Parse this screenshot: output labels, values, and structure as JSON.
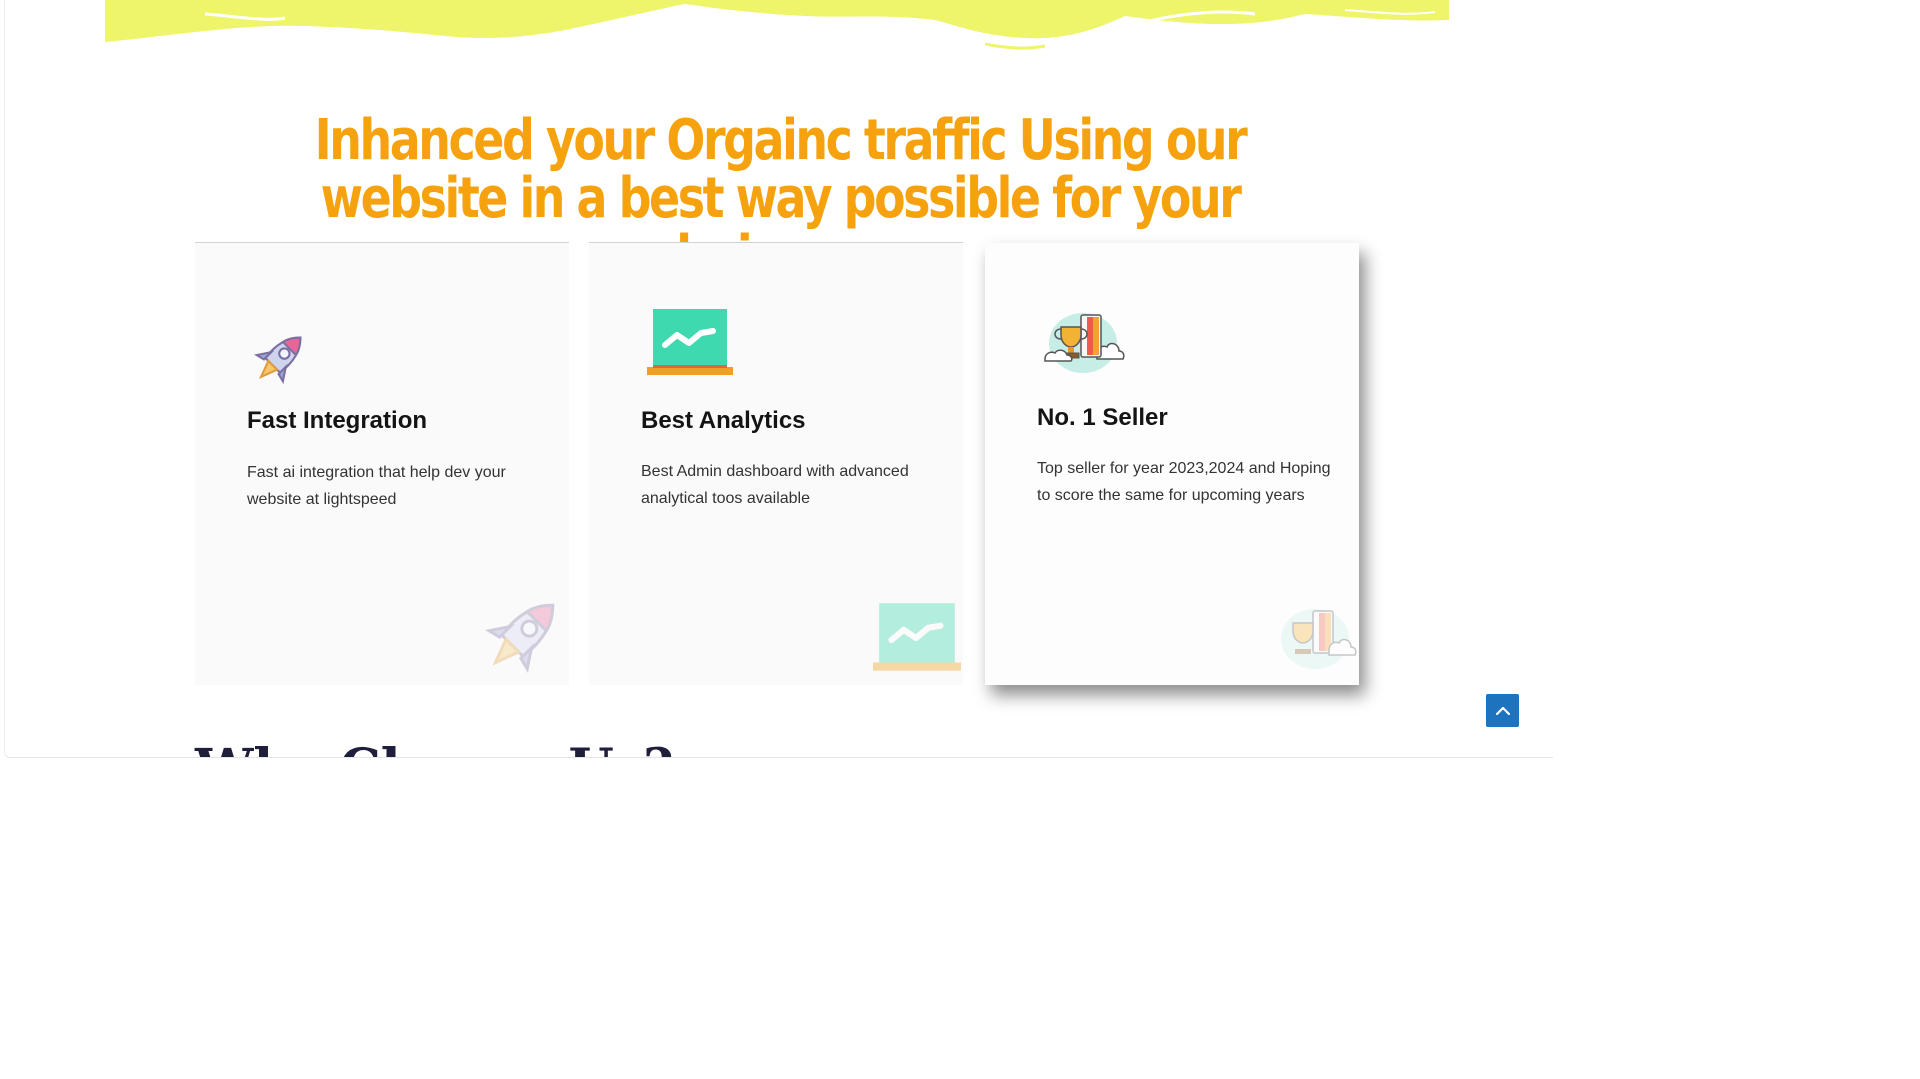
{
  "headline": "Inhanced your Orgainc traffic Using our website in a best way possible for your buisness",
  "features": [
    {
      "icon": "rocket-icon",
      "title": "Fast Integration",
      "description": "Fast ai integration that help dev your website at lightspeed"
    },
    {
      "icon": "analytics-chart-icon",
      "title": "Best Analytics",
      "description": "Best Admin dashboard with advanced analytical toos available"
    },
    {
      "icon": "trophy-icon",
      "title": "No. 1 Seller",
      "description": "Top seller for year 2023,2024 and Hoping to score the same for upcoming years"
    }
  ],
  "next_section": {
    "title": "Why Choose Us?"
  },
  "scroll_top": {
    "icon": "chevron-up-icon"
  },
  "colors": {
    "headline": "#f6a20e",
    "wave": "#eef56a",
    "analytics_green": "#3fd9b0",
    "analytics_base": "#f0a020",
    "scroll_button": "#1e73be"
  }
}
